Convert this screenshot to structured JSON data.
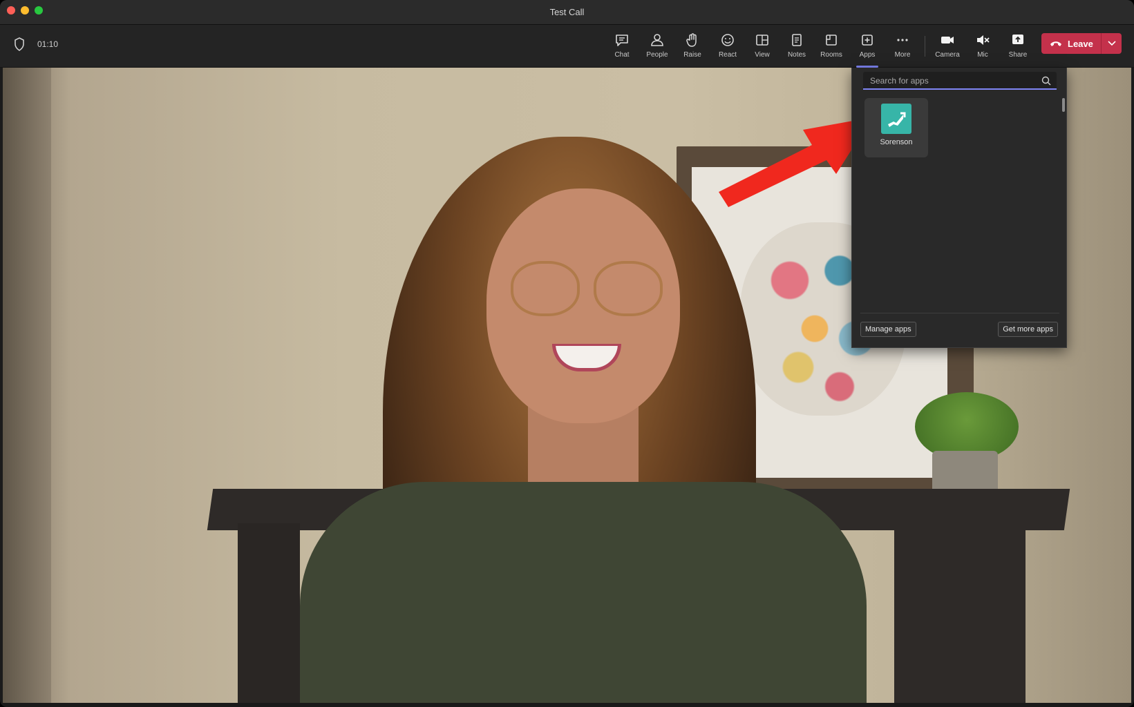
{
  "window": {
    "title": "Test Call"
  },
  "meeting": {
    "timer": "01:10"
  },
  "toolbar": {
    "chat": "Chat",
    "people": "People",
    "raise": "Raise",
    "react": "React",
    "view": "View",
    "notes": "Notes",
    "rooms": "Rooms",
    "apps": "Apps",
    "more": "More",
    "camera": "Camera",
    "mic": "Mic",
    "share": "Share",
    "leave": "Leave"
  },
  "apps_panel": {
    "search_placeholder": "Search for apps",
    "apps": [
      {
        "name": "Sorenson"
      }
    ],
    "manage_label": "Manage apps",
    "get_more_label": "Get more apps"
  },
  "colors": {
    "accent": "#7f85f5",
    "leave_red": "#c4314b",
    "annotation_arrow": "#f0281e",
    "app_logo": "#37b5a8"
  },
  "icons": [
    "shield-icon",
    "chat-icon",
    "people-icon",
    "raise-hand-icon",
    "react-icon",
    "view-icon",
    "notes-icon",
    "rooms-icon",
    "apps-icon",
    "more-icon",
    "camera-icon",
    "mic-muted-icon",
    "share-icon",
    "phone-hangup-icon",
    "chevron-down-icon",
    "search-icon",
    "sorenson-logo-icon",
    "arrow-annotation-icon"
  ]
}
